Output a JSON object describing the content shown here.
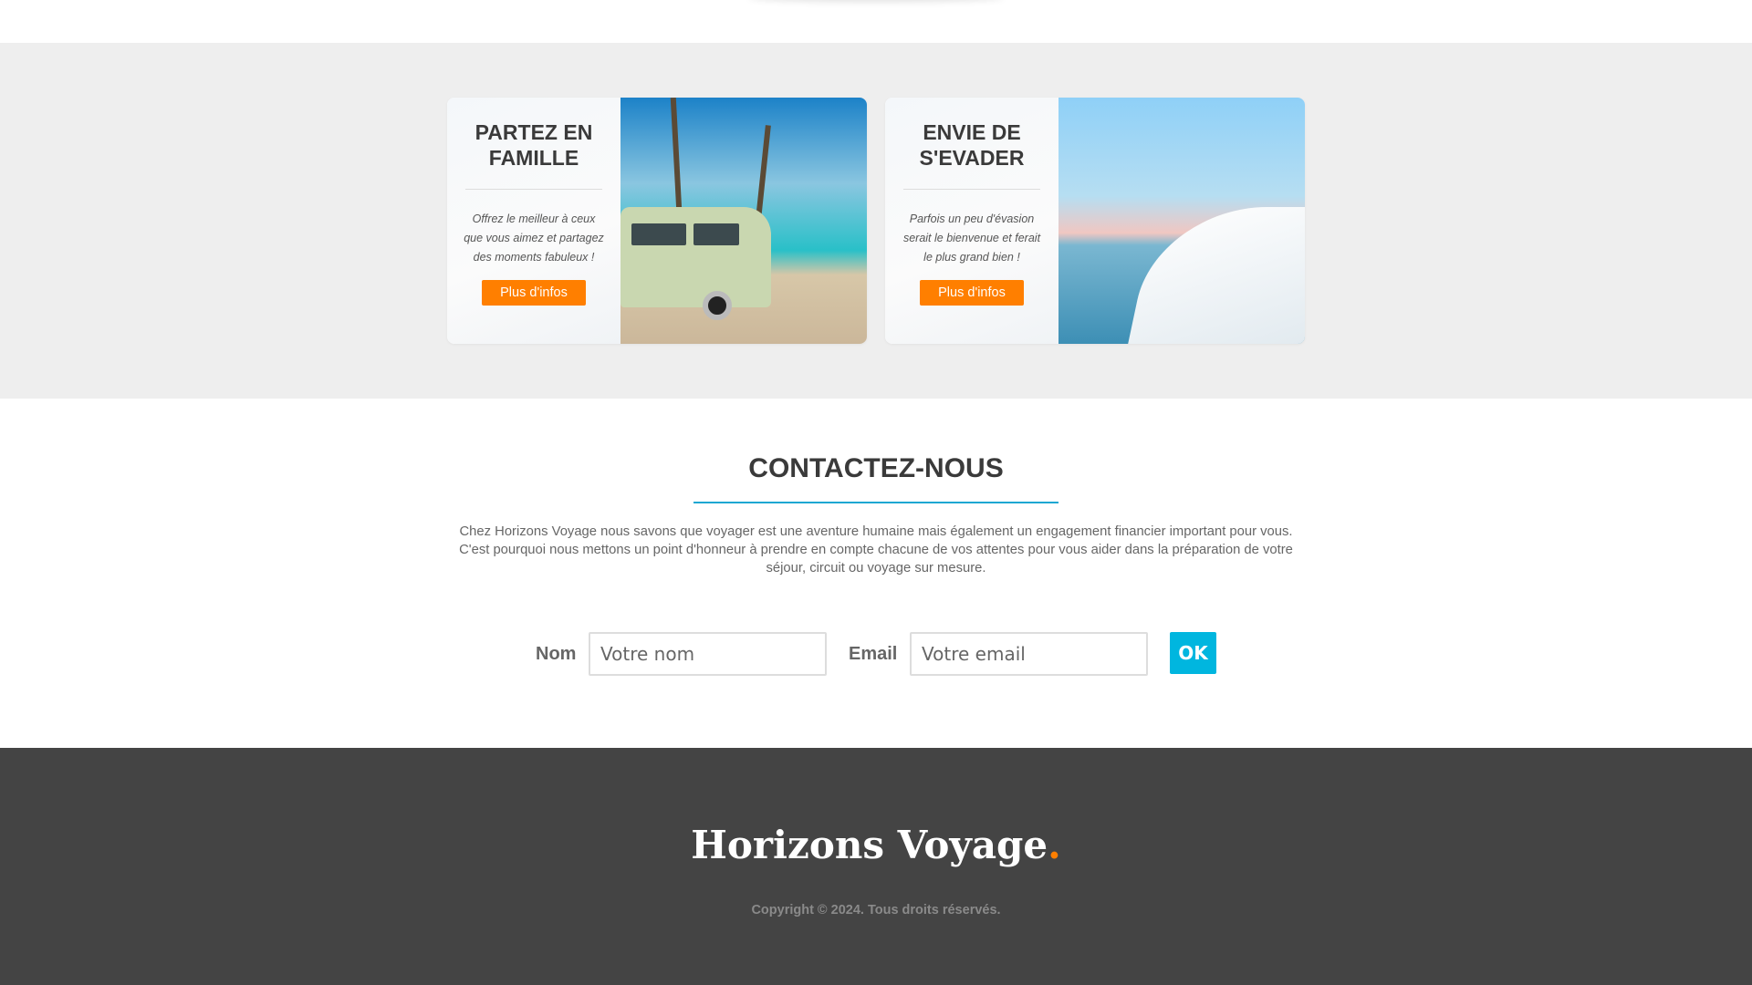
{
  "promos": [
    {
      "title": "PARTEZ EN FAMILLE",
      "text": "Offrez le meilleur à ceux que vous aimez et partagez des moments fabuleux !",
      "button": "Plus d'infos"
    },
    {
      "title": "ENVIE DE S'EVADER",
      "text": "Parfois un peu d'évasion serait le bienvenue et ferait le plus grand bien !",
      "button": "Plus d'infos"
    }
  ],
  "contact": {
    "title": "CONTACTEZ-NOUS",
    "text": "Chez Horizons Voyage nous savons que voyager est une aventure humaine mais également un engagement financier important pour vous. C'est pourquoi nous mettons un point d'honneur à prendre en compte chacune de vos attentes pour vous aider dans la préparation de votre séjour, circuit ou voyage sur mesure.",
    "name_label": "Nom",
    "name_placeholder": "Votre nom",
    "email_label": "Email",
    "email_placeholder": "Votre email",
    "submit": "OK"
  },
  "footer": {
    "brand": "Horizons Voyage",
    "brand_dot": ".",
    "copyright": "Copyright © 2024. Tous droits réservés."
  },
  "colors": {
    "accent": "#ff7f00",
    "primary": "#00b6df",
    "footer_bg": "#444444"
  }
}
